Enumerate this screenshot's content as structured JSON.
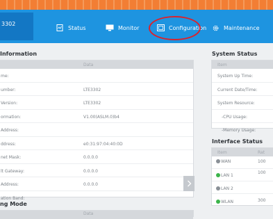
{
  "brand": {
    "model": "3302"
  },
  "nav": [
    {
      "label": "Status",
      "icon": "status-icon"
    },
    {
      "label": "Monitor",
      "icon": "monitor-icon"
    },
    {
      "label": "Configuration",
      "icon": "configuration-icon"
    },
    {
      "label": "Maintenance",
      "icon": "maintenance-icon"
    }
  ],
  "device_info": {
    "title": "Information",
    "header": "Data",
    "rows": [
      {
        "label": "me:",
        "value": ""
      },
      {
        "label": "umber:",
        "value": "LTE3302"
      },
      {
        "label": "Version:",
        "value": "LTE3302"
      },
      {
        "label": "ormation:",
        "value": "V1.00(ASLM.0)b4"
      },
      {
        "label": "Address:",
        "value": ""
      },
      {
        "label": "ddress:",
        "value": "e0:31:97:04:40:0D"
      },
      {
        "label": "net Mask:",
        "value": "0.0.0.0"
      },
      {
        "label": "lt Gateway:",
        "value": "0.0.0.0"
      },
      {
        "label": "Address:",
        "value": "0.0.0.0"
      },
      {
        "label": "ation Band:",
        "value": ""
      }
    ]
  },
  "mode_section": {
    "title": "ng Mode",
    "header": "Data"
  },
  "system_status": {
    "title": "System Status",
    "header": "Item",
    "rows": [
      {
        "label": "System Up Time:"
      },
      {
        "label": "Current Date/Time:"
      },
      {
        "label": "System Resource:"
      },
      {
        "label": "-CPU Usage:"
      },
      {
        "label": "-Memory Usage:"
      }
    ]
  },
  "interface_status": {
    "title": "Interface Status",
    "header_item": "Item",
    "header_rate": "Rat",
    "rows": [
      {
        "name": "WAN",
        "status": "down",
        "rate": "100"
      },
      {
        "name": "LAN 1",
        "status": "up",
        "rate": "100"
      },
      {
        "name": "LAN 2",
        "status": "down",
        "rate": ""
      },
      {
        "name": "WLAN",
        "status": "up",
        "rate": "300"
      }
    ]
  },
  "colors": {
    "nav": "#1e94e0",
    "up": "#3cb44b",
    "down": "#8a9097",
    "highlight": "#d9232d"
  }
}
